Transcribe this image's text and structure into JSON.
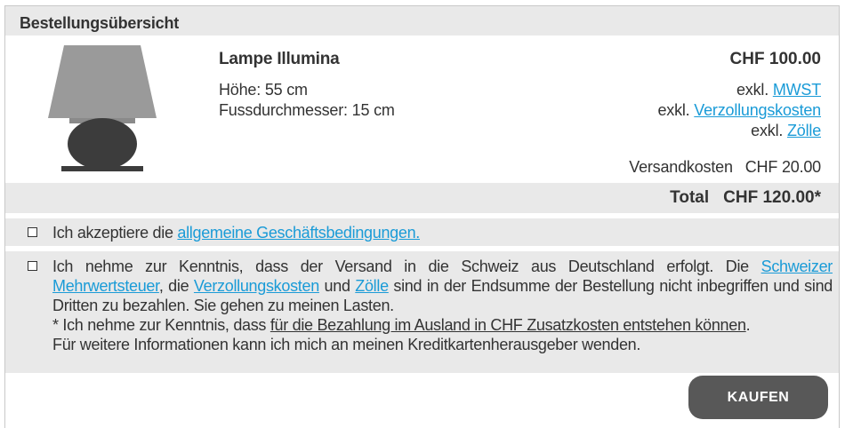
{
  "header": {
    "title": "Bestellungsübersicht"
  },
  "product": {
    "name": "Lampe Illumina",
    "height": "Höhe: 55 cm",
    "foot_diameter": "Fussdurchmesser: 15 cm",
    "price": "CHF 100.00"
  },
  "taxes": {
    "prefix": "exkl.",
    "mwst_link": "MWST",
    "customs_link": "Verzollungskosten",
    "duties_link": "Zölle"
  },
  "shipping": {
    "label": "Versandkosten",
    "value": "CHF 20.00"
  },
  "total": {
    "label": "Total",
    "value": "CHF 120.00*"
  },
  "terms": {
    "prefix": "Ich akzeptiere die ",
    "link": "allgemeine Geschäftsbedingungen."
  },
  "notice": {
    "t1": "Ich nehme zur Kenntnis, dass der Versand in die Schweiz aus Deutschland erfolgt. Die ",
    "link_vat": "Schweizer Mehrwertsteuer",
    "t2": ", die ",
    "link_customs": "Verzollungskosten",
    "t3": " und ",
    "link_duties": "Zölle",
    "t4": " sind in der Endsumme der Bestellung nicht inbegriffen und sind Dritten zu bezahlen. Sie gehen zu meinen Lasten.",
    "t5": "* Ich nehme zur Kenntnis, dass ",
    "underlined": "für die Bezahlung im Ausland in CHF Zusatzkosten entstehen können",
    "t6": ".",
    "t7": "Für weitere Informationen kann ich mich an meinen Kreditkartenherausgeber wenden."
  },
  "buy_button": {
    "label": "KAUFEN"
  },
  "colors": {
    "link": "#1a9bd7",
    "panel": "#e9e9e9",
    "button": "#585858",
    "lamp_shade": "#9a9a9a",
    "lamp_base": "#3c3c3c"
  }
}
